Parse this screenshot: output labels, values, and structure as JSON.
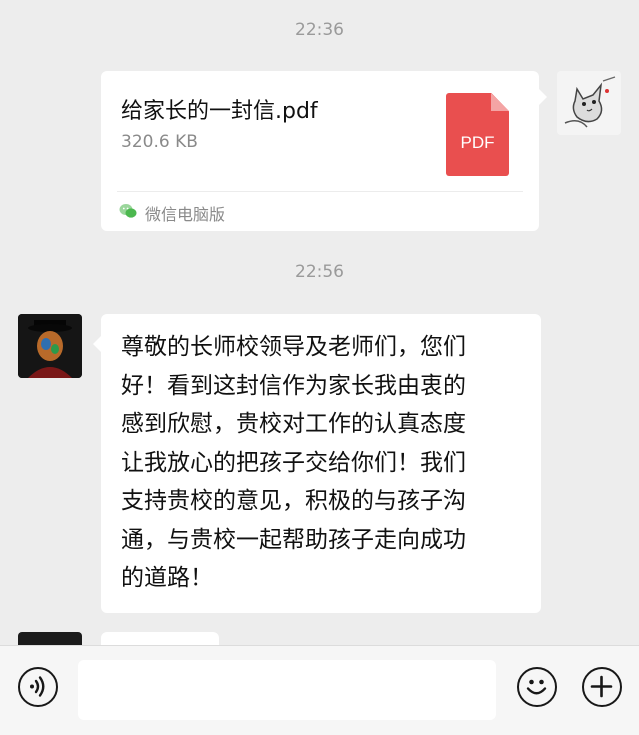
{
  "messages": {
    "time_1": "22:36",
    "file": {
      "name": "给家长的一封信.pdf",
      "size": "320.6 KB",
      "type_label": "PDF",
      "source": "微信电脑版"
    },
    "time_2": "22:56",
    "text": "尊敬的长师校领导及老师们，您们\n好！看到这封信作为家长我由衷的\n感到欣慰，贵校对工作的认真态度\n让我放心的把孩子交给你们！我们\n支持贵校的意见，积极的与孩子沟\n通，与贵校一起帮助孩子走向成功\n的道路！"
  },
  "input_bar": {
    "voice_icon": "voice-icon",
    "emoji_icon": "emoji-icon",
    "plus_icon": "plus-icon",
    "input_value": ""
  },
  "colors": {
    "background": "#ededed",
    "bubble": "#ffffff",
    "pdf_red": "#e94f4f",
    "wechat_green": "#07c160"
  }
}
